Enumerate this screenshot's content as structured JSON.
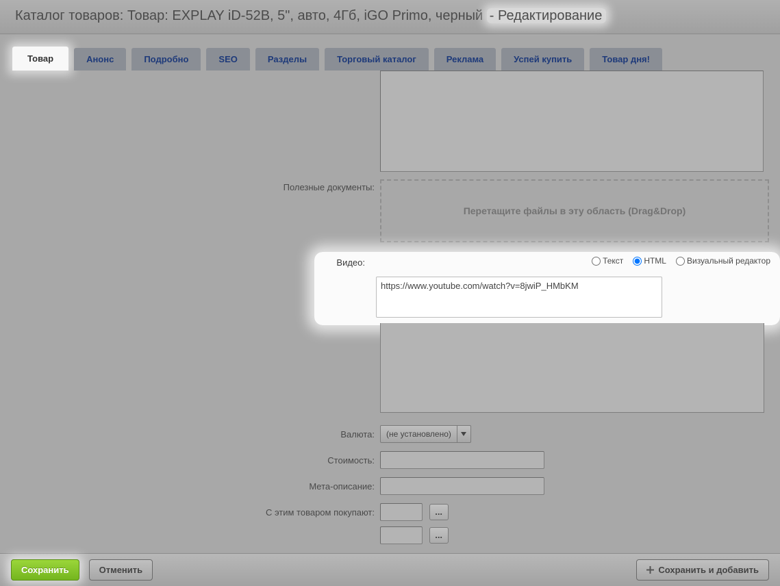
{
  "header": {
    "title_prefix": "Каталог товаров: Товар: EXPLAY iD-52B, 5\", авто, 4Гб, iGO Primo, черный",
    "title_suffix": "- Редактирование"
  },
  "tabs": [
    {
      "id": "product",
      "label": "Товар",
      "active": true
    },
    {
      "id": "anons",
      "label": "Анонс",
      "active": false
    },
    {
      "id": "detail",
      "label": "Подробно",
      "active": false
    },
    {
      "id": "seo",
      "label": "SEO",
      "active": false
    },
    {
      "id": "sections",
      "label": "Разделы",
      "active": false
    },
    {
      "id": "catalog",
      "label": "Торговый каталог",
      "active": false
    },
    {
      "id": "ads",
      "label": "Реклама",
      "active": false
    },
    {
      "id": "buy",
      "label": "Успей купить",
      "active": false
    },
    {
      "id": "day",
      "label": "Товар дня!",
      "active": false
    }
  ],
  "form": {
    "docs_label": "Полезные документы:",
    "dropzone_text": "Перетащите файлы в эту область (Drag&Drop)",
    "video_label": "Видео:",
    "video_value": "https://www.youtube.com/watch?v=8jwiP_HMbKM",
    "video_modes": {
      "text": "Текст",
      "html": "HTML",
      "visual": "Визуальный редактор"
    },
    "currency_label": "Валюта:",
    "currency_value": "(не установлено)",
    "price_label": "Стоимость:",
    "price_value": "",
    "meta_label": "Мета-описание:",
    "meta_value": "",
    "related_label": "С этим товаром покупают:",
    "related_value1": "",
    "related_value2": "",
    "ellipsis": "..."
  },
  "footer": {
    "save": "Сохранить",
    "cancel": "Отменить",
    "save_add": "Сохранить и добавить"
  }
}
